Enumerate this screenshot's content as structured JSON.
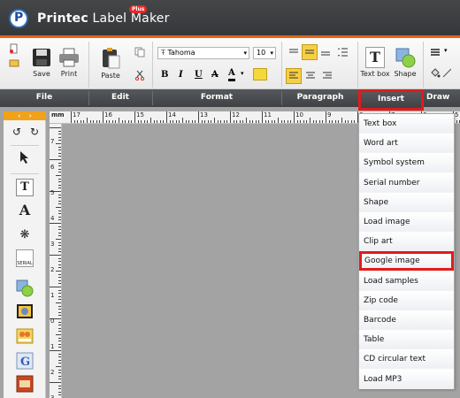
{
  "app": {
    "title_brand": "Printec",
    "title_rest": " Label Maker",
    "badge": "Plus"
  },
  "ribbon": {
    "save": "Save",
    "print": "Print",
    "paste": "Paste",
    "font_name": "Tahoma",
    "font_size": "10",
    "bold": "B",
    "italic": "I",
    "underline": "U",
    "strike": "A",
    "font_color": "A",
    "text_box": "Text box",
    "shape": "Shape"
  },
  "groups": {
    "file": "File",
    "edit": "Edit",
    "format": "Format",
    "paragraph": "Paragraph",
    "insert": "Insert",
    "draw": "Draw"
  },
  "lefttool": {
    "undo": "↺",
    "redo": "↻"
  },
  "ruler": {
    "unit": "mm",
    "top_labels": [
      "17",
      "16",
      "15",
      "14",
      "13",
      "12",
      "11",
      "10",
      "9",
      "8",
      "7",
      "6",
      "5",
      "4"
    ],
    "left_labels": [
      "7",
      "6",
      "5",
      "4",
      "3",
      "2",
      "1",
      "0",
      "1",
      "2",
      "3"
    ]
  },
  "insert_menu": {
    "items": [
      "Text box",
      "Word art",
      "Symbol system",
      "Serial number",
      "Shape",
      "Load image",
      "Clip art",
      "Google image",
      "Load samples",
      "Zip code",
      "Barcode",
      "Table",
      "CD  circular text",
      "Load MP3"
    ]
  }
}
